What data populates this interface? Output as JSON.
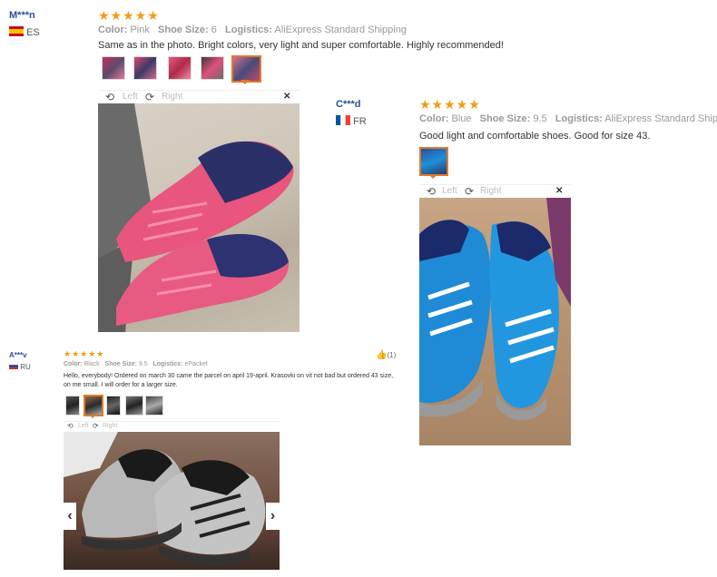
{
  "reviews": [
    {
      "user": "M***n",
      "country": "ES",
      "stars": "★★★★★",
      "color_label": "Color:",
      "color_value": "Pink",
      "size_label": "Shoe Size:",
      "size_value": "6",
      "logistics_label": "Logistics:",
      "logistics_value": "AliExpress Standard Shipping",
      "text": "Same as in the photo. Bright colors, very light and super comfortable. Highly recommended!",
      "viewer": {
        "left": "Left",
        "right": "Right",
        "close": "✕"
      }
    },
    {
      "user": "C***d",
      "country": "FR",
      "stars": "★★★★★",
      "color_label": "Color:",
      "color_value": "Blue",
      "size_label": "Shoe Size:",
      "size_value": "9.5",
      "logistics_label": "Logistics:",
      "logistics_value": "AliExpress Standard Shipping",
      "text": "Good light and comfortable shoes. Good for size 43.",
      "viewer": {
        "left": "Left",
        "right": "Right",
        "close": "✕"
      }
    },
    {
      "user": "A***v",
      "country": "RU",
      "stars": "★★★★★",
      "color_label": "Color:",
      "color_value": "Black",
      "size_label": "Shoe Size:",
      "size_value": "9.5",
      "logistics_label": "Logistics:",
      "logistics_value": "ePacket",
      "helpful_count": "(1)",
      "text": "Hello, everybody! Ordered on march 30 came the parcel on april 19-april. Krasovki on vit not bad but ordered 43 size, on me small. I will order for a larger size.",
      "viewer": {
        "left": "Left",
        "right": "Right"
      }
    }
  ],
  "colors": {
    "star": "#f29b14",
    "user": "#2a4f9c",
    "selected_thumb": "#e07a2a"
  }
}
